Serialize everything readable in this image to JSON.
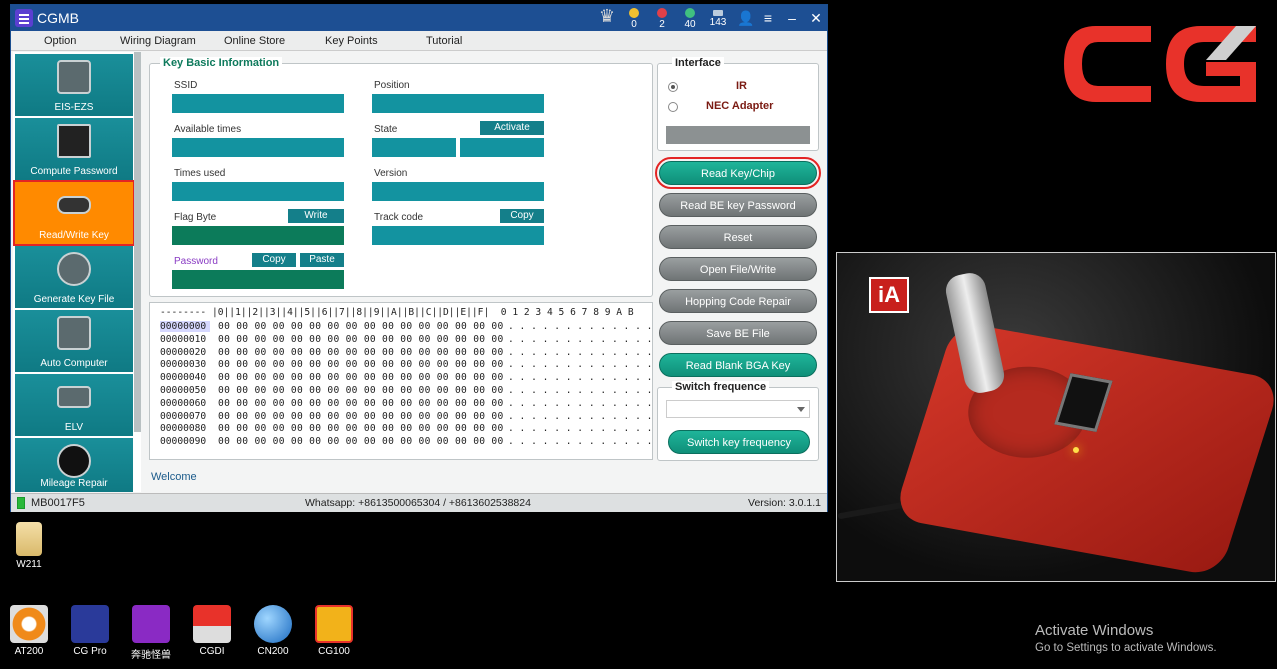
{
  "app": {
    "title": "CGMB",
    "stats": {
      "gold": "0",
      "gem_red": "2",
      "gem_green": "40",
      "bars": "143"
    },
    "colors": {
      "titlebar": "#1d4f93",
      "teal": "#1393a0",
      "active": "#ff8a00",
      "highlight": "#e32424"
    }
  },
  "menu": [
    "Option",
    "Wiring Diagram",
    "Online Store",
    "Key Points",
    "Tutorial"
  ],
  "nav": [
    {
      "label": "EIS-EZS",
      "icon": "eis-ezs-icon"
    },
    {
      "label": "Compute Password",
      "icon": "compute-password-icon"
    },
    {
      "label": "Read/Write Key",
      "icon": "read-write-key-icon",
      "active": true
    },
    {
      "label": "Generate Key File",
      "icon": "generate-key-file-icon"
    },
    {
      "label": "Auto Computer",
      "icon": "auto-computer-icon"
    },
    {
      "label": "ELV",
      "icon": "elv-icon"
    },
    {
      "label": "Mileage Repair",
      "icon": "mileage-repair-icon"
    }
  ],
  "key_info": {
    "legend": "Key Basic Information",
    "ssid": "SSID",
    "position": "Position",
    "available_times": "Available times",
    "state": "State",
    "activate": "Activate",
    "times_used": "Times used",
    "version": "Version",
    "flag_byte": "Flag Byte",
    "write": "Write",
    "track_code": "Track code",
    "copy": "Copy",
    "password": "Password",
    "copy2": "Copy",
    "paste": "Paste"
  },
  "hex": {
    "header": "-------- |0||1||2||3||4||5||6||7||8||9||A||B||C||D||E||F|  0 1 2 3 4 5 6 7 8 9 A B",
    "rows": [
      {
        "addr": "00000000",
        "bytes": "00 00 00 00 00 00 00 00 00 00 00 00 00 00 00 00",
        "ascii": ". . . . . . . . . . . . ."
      },
      {
        "addr": "00000010",
        "bytes": "00 00 00 00 00 00 00 00 00 00 00 00 00 00 00 00",
        "ascii": ". . . . . . . . . . . . ."
      },
      {
        "addr": "00000020",
        "bytes": "00 00 00 00 00 00 00 00 00 00 00 00 00 00 00 00",
        "ascii": ". . . . . . . . . . . . ."
      },
      {
        "addr": "00000030",
        "bytes": "00 00 00 00 00 00 00 00 00 00 00 00 00 00 00 00",
        "ascii": ". . . . . . . . . . . . ."
      },
      {
        "addr": "00000040",
        "bytes": "00 00 00 00 00 00 00 00 00 00 00 00 00 00 00 00",
        "ascii": ". . . . . . . . . . . . ."
      },
      {
        "addr": "00000050",
        "bytes": "00 00 00 00 00 00 00 00 00 00 00 00 00 00 00 00",
        "ascii": ". . . . . . . . . . . . ."
      },
      {
        "addr": "00000060",
        "bytes": "00 00 00 00 00 00 00 00 00 00 00 00 00 00 00 00",
        "ascii": ". . . . . . . . . . . . ."
      },
      {
        "addr": "00000070",
        "bytes": "00 00 00 00 00 00 00 00 00 00 00 00 00 00 00 00",
        "ascii": ". . . . . . . . . . . . ."
      },
      {
        "addr": "00000080",
        "bytes": "00 00 00 00 00 00 00 00 00 00 00 00 00 00 00 00",
        "ascii": ". . . . . . . . . . . . ."
      },
      {
        "addr": "00000090",
        "bytes": "00 00 00 00 00 00 00 00 00 00 00 00 00 00 00 00",
        "ascii": ". . . . . . . . . . . . ."
      }
    ]
  },
  "welcome": "Welcome",
  "interface": {
    "legend": "Interface",
    "ir": "IR",
    "nec": "NEC Adapter",
    "selected": "IR"
  },
  "actions": [
    {
      "label": "Read Key/Chip",
      "style": "teal",
      "highlight": true
    },
    {
      "label": "Read BE key Password",
      "style": "gray"
    },
    {
      "label": "Reset",
      "style": "gray"
    },
    {
      "label": "Open File/Write",
      "style": "gray"
    },
    {
      "label": "Hopping Code Repair",
      "style": "gray"
    },
    {
      "label": "Save BE File",
      "style": "gray"
    },
    {
      "label": "Read Blank BGA Key",
      "style": "teal"
    }
  ],
  "switch_freq": {
    "legend": "Switch frequence",
    "select_value": "",
    "button": "Switch key frequency"
  },
  "status": {
    "device": "MB0017F5",
    "contact": "Whatsapp: +8613500065304 / +8613602538824",
    "version": "Version: 3.0.1.1"
  },
  "desktop": {
    "folder": "W211",
    "taskbar": [
      "AT200",
      "CG Pro",
      "奔驰怪兽",
      "CGDI",
      "CN200",
      "CG100"
    ]
  },
  "video_badge": "iA",
  "activate": {
    "line1": "Activate Windows",
    "line2": "Go to Settings to activate Windows."
  }
}
